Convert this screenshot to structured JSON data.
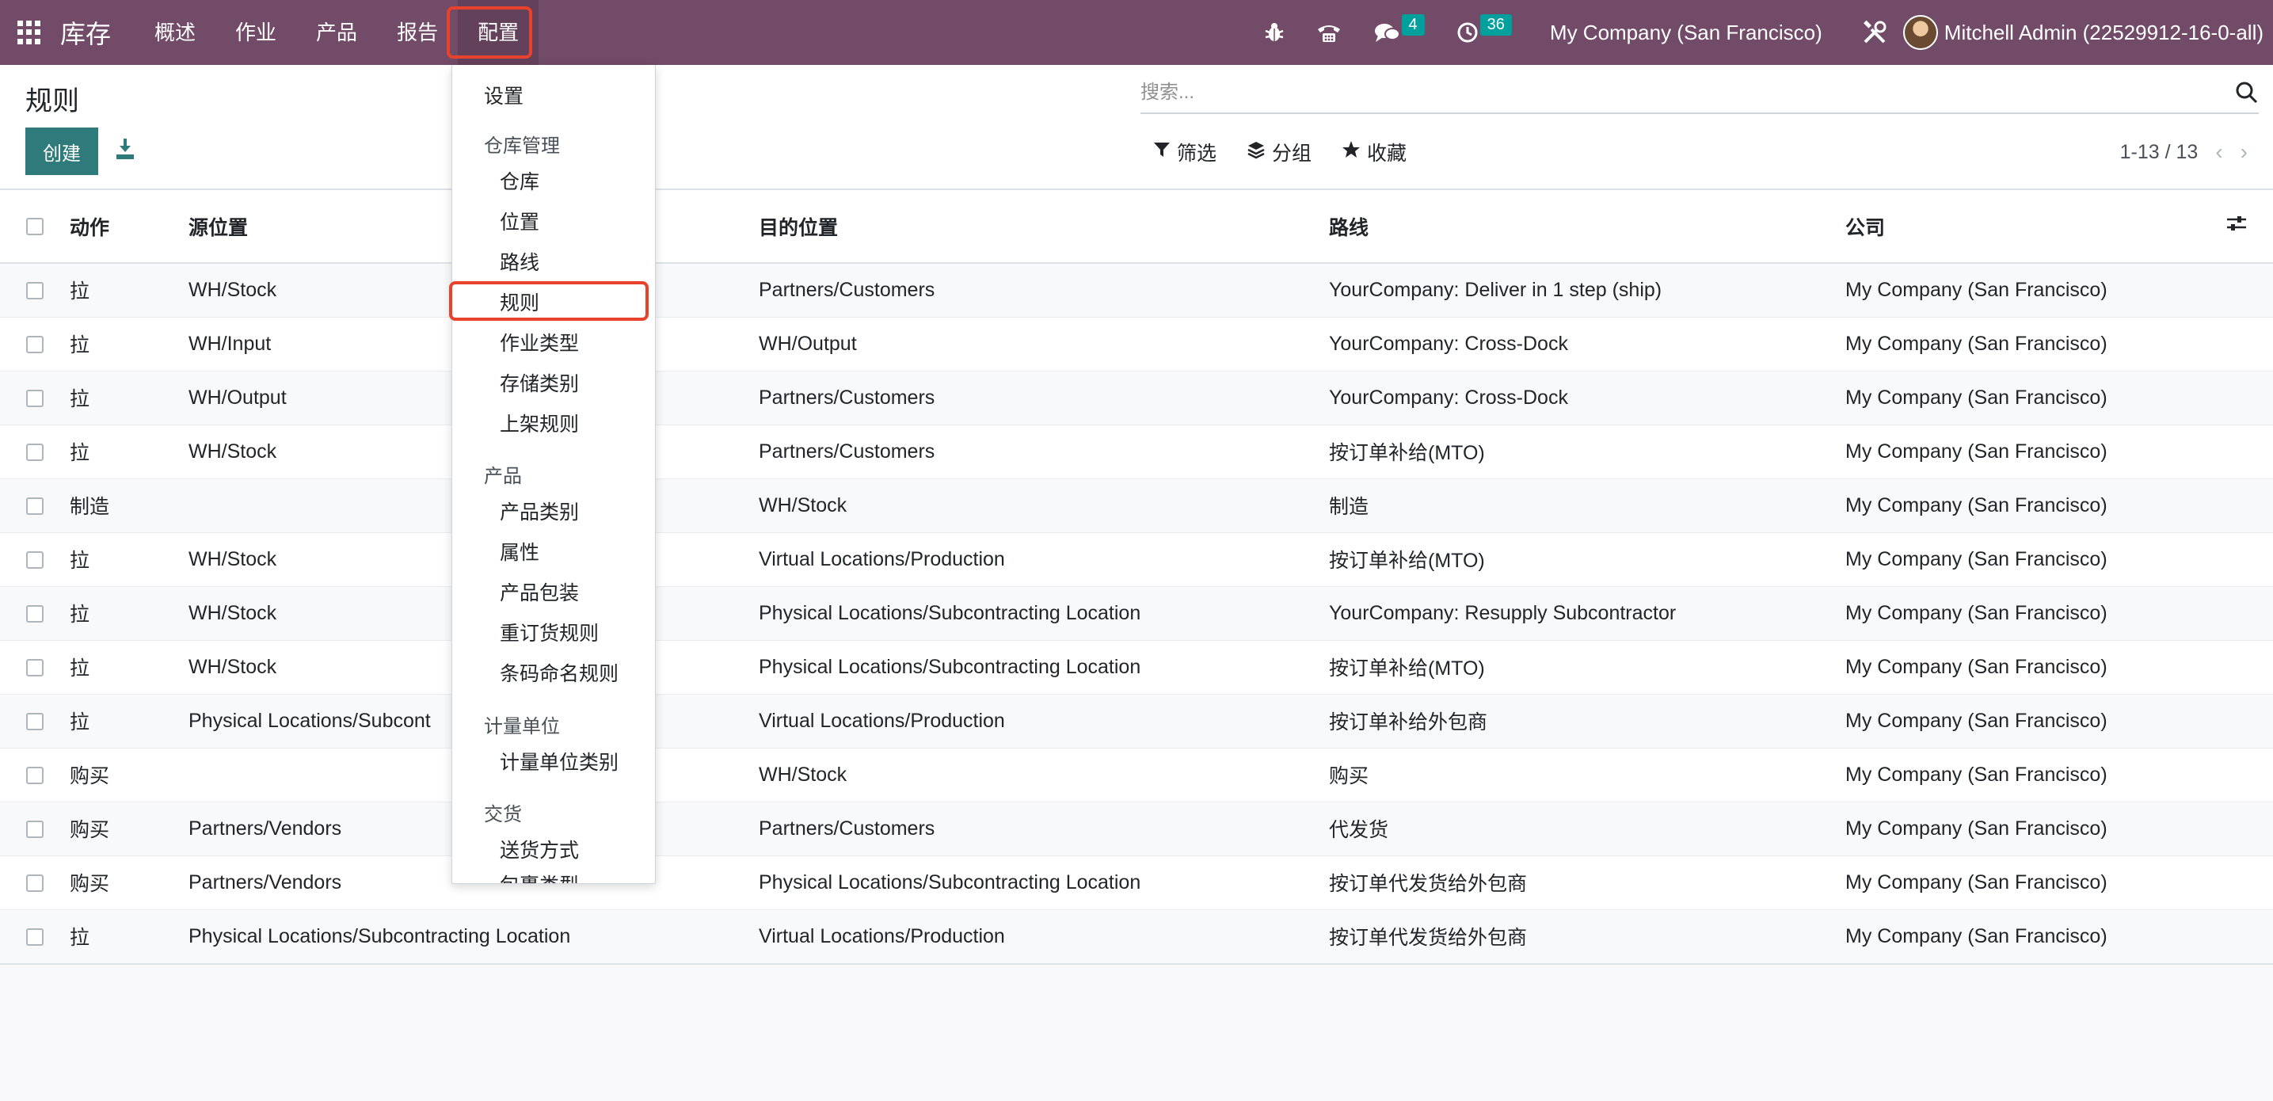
{
  "navbar": {
    "brand": "库存",
    "menus": [
      "概述",
      "作业",
      "产品",
      "报告",
      "配置"
    ],
    "active_menu": "配置",
    "messages_count": "4",
    "activities_count": "36",
    "company": "My Company (San Francisco)",
    "user": "Mitchell Admin (22529912-16-0-all)",
    "icons": [
      "apps-icon",
      "bug-icon",
      "phone-icon",
      "chat-icon",
      "clock-icon",
      "tools-icon",
      "avatar"
    ]
  },
  "control": {
    "title": "规则",
    "create_label": "创建",
    "search_placeholder": "搜索...",
    "filter_label": "筛选",
    "group_label": "分组",
    "favorite_label": "收藏",
    "pager": "1-13 / 13"
  },
  "table": {
    "headers": [
      "动作",
      "源位置",
      "目的位置",
      "路线",
      "公司"
    ],
    "rows": [
      {
        "action": "拉",
        "source": "WH/Stock",
        "dest": "Partners/Customers",
        "route": "YourCompany: Deliver in 1 step (ship)",
        "company": "My Company (San Francisco)"
      },
      {
        "action": "拉",
        "source": "WH/Input",
        "dest": "WH/Output",
        "route": "YourCompany: Cross-Dock",
        "company": "My Company (San Francisco)"
      },
      {
        "action": "拉",
        "source": "WH/Output",
        "dest": "Partners/Customers",
        "route": "YourCompany: Cross-Dock",
        "company": "My Company (San Francisco)"
      },
      {
        "action": "拉",
        "source": "WH/Stock",
        "dest": "Partners/Customers",
        "route": "按订单补给(MTO)",
        "company": "My Company (San Francisco)"
      },
      {
        "action": "制造",
        "source": "",
        "dest": "WH/Stock",
        "route": "制造",
        "company": "My Company (San Francisco)"
      },
      {
        "action": "拉",
        "source": "WH/Stock",
        "dest": "Virtual Locations/Production",
        "route": "按订单补给(MTO)",
        "company": "My Company (San Francisco)"
      },
      {
        "action": "拉",
        "source": "WH/Stock",
        "dest": "Physical Locations/Subcontracting Location",
        "route": "YourCompany: Resupply Subcontractor",
        "company": "My Company (San Francisco)"
      },
      {
        "action": "拉",
        "source": "WH/Stock",
        "dest": "Physical Locations/Subcontracting Location",
        "route": "按订单补给(MTO)",
        "company": "My Company (San Francisco)"
      },
      {
        "action": "拉",
        "source": "Physical Locations/Subcont",
        "dest": "Virtual Locations/Production",
        "route": "按订单补给外包商",
        "company": "My Company (San Francisco)"
      },
      {
        "action": "购买",
        "source": "",
        "dest": "WH/Stock",
        "route": "购买",
        "company": "My Company (San Francisco)"
      },
      {
        "action": "购买",
        "source": "Partners/Vendors",
        "dest": "Partners/Customers",
        "route": "代发货",
        "company": "My Company (San Francisco)"
      },
      {
        "action": "购买",
        "source": "Partners/Vendors",
        "dest": "Physical Locations/Subcontracting Location",
        "route": "按订单代发货给外包商",
        "company": "My Company (San Francisco)"
      },
      {
        "action": "拉",
        "source": "Physical Locations/Subcontracting Location",
        "dest": "Virtual Locations/Production",
        "route": "按订单代发货给外包商",
        "company": "My Company (San Francisco)"
      }
    ]
  },
  "dropdown": {
    "settings": "设置",
    "sections": [
      {
        "title": "仓库管理",
        "items": [
          "仓库",
          "位置",
          "路线",
          "规则",
          "作业类型",
          "存储类别",
          "上架规则"
        ]
      },
      {
        "title": "产品",
        "items": [
          "产品类别",
          "属性",
          "产品包装",
          "重订货规则",
          "条码命名规则"
        ]
      },
      {
        "title": "计量单位",
        "items": [
          "计量单位类别"
        ]
      },
      {
        "title": "交货",
        "items": [
          "送货方式",
          "包裹类型"
        ]
      }
    ],
    "highlighted_item": "规则"
  }
}
